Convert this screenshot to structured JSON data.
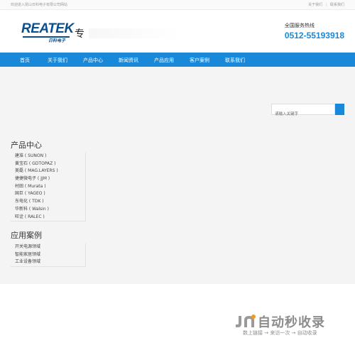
{
  "topbar": {
    "welcome": "欢迎进入昆山日科电子有限公司网站",
    "links": [
      "关于我们",
      "联系我们"
    ],
    "separator": "|"
  },
  "header": {
    "logo_brand": "REATEK",
    "logo_cn": "日科电子",
    "slogan": "专",
    "hotline_label": "全国服务热线",
    "hotline_number": "0512-55193918"
  },
  "nav": {
    "items": [
      "首页",
      "关于我们",
      "产品中心",
      "新闻资讯",
      "产品应用",
      "客户案例",
      "联系我们"
    ]
  },
  "search": {
    "placeholder": "请输入关键字"
  },
  "products": {
    "title": "产品中心",
    "items": [
      "建准 ( SUNON )",
      "黄宝石 ( GDTOPAZ )",
      "美磊 ( MAG.LAYERS )",
      "捷捷微电子 ( JJM )",
      "村田 ( Murata )",
      "国巨 ( YAGEO )",
      "东电化 ( TDK )",
      "华新科 ( Walsin )",
      "旺诠 ( RALEC )"
    ]
  },
  "cases": {
    "title": "应用案例",
    "items": [
      "开关电源领域",
      "智能家居领域",
      "工业设备领域"
    ]
  },
  "watermark": {
    "text": "自动秒收录",
    "sub": "数上链接 → 来访一次 → 自动收录"
  },
  "colors": {
    "nav_blue": "#1a88d8",
    "brand_blue": "#0b4f8c",
    "content_bg": "#f4f4f4"
  }
}
